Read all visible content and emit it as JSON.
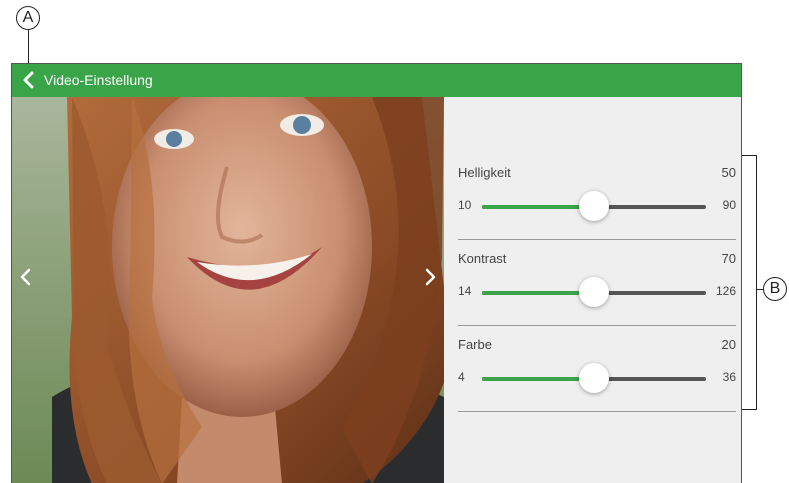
{
  "callouts": {
    "a": "A",
    "b": "B"
  },
  "header": {
    "title": "Video-Einstellung",
    "back_icon": "chevron-left-icon"
  },
  "video": {
    "prev_icon": "chevron-left-icon",
    "next_icon": "chevron-right-icon"
  },
  "settings": [
    {
      "label": "Helligkeit",
      "value": "50",
      "min": "10",
      "max": "90",
      "fraction": 0.5
    },
    {
      "label": "Kontrast",
      "value": "70",
      "min": "14",
      "max": "126",
      "fraction": 0.5
    },
    {
      "label": "Farbe",
      "value": "20",
      "min": "4",
      "max": "36",
      "fraction": 0.5
    }
  ],
  "colors": {
    "accent": "#3aa449",
    "panel_bg": "#efefef"
  }
}
